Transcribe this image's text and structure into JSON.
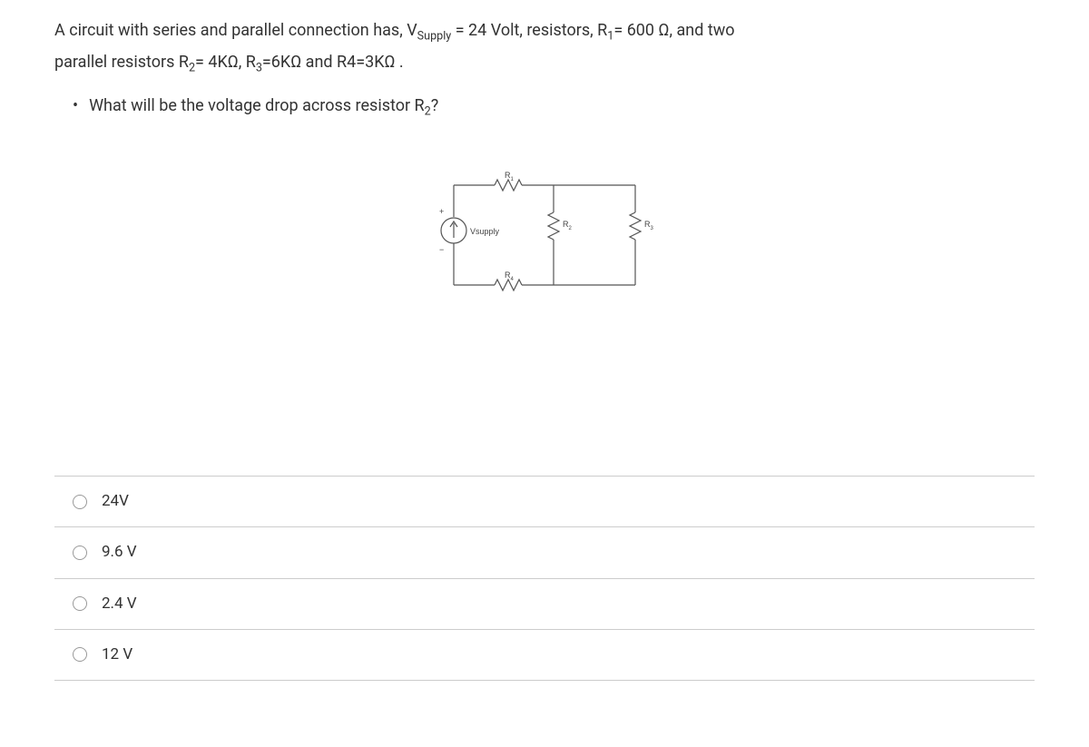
{
  "question": {
    "line1_pre": "A circuit with series and parallel connection has, V",
    "line1_sub1": "Supply",
    "line1_mid1": " = 24 Volt,  resistors, R",
    "line1_sub2": "1",
    "line1_mid2": "= 600 Ω, and two",
    "line2_pre": "parallel resistors R",
    "line2_sub1": "2",
    "line2_mid1": "= 4KΩ,  R",
    "line2_sub2": "3",
    "line2_mid2": "=6KΩ and  R4=3KΩ .",
    "bullet_pre": "What will be the voltage drop across resistor R",
    "bullet_sub": "2",
    "bullet_post": "?"
  },
  "diagram": {
    "vsupply": "Vsupply",
    "r1": "R",
    "r1_sub": "1",
    "r2": "R",
    "r2_sub": "2",
    "r3": "R",
    "r3_sub": "3",
    "r4": "R",
    "r4_sub": "4",
    "plus": "+",
    "minus": "−"
  },
  "answers": [
    {
      "label": "24V"
    },
    {
      "label": "9.6 V"
    },
    {
      "label": "2.4 V"
    },
    {
      "label": "12 V"
    }
  ]
}
